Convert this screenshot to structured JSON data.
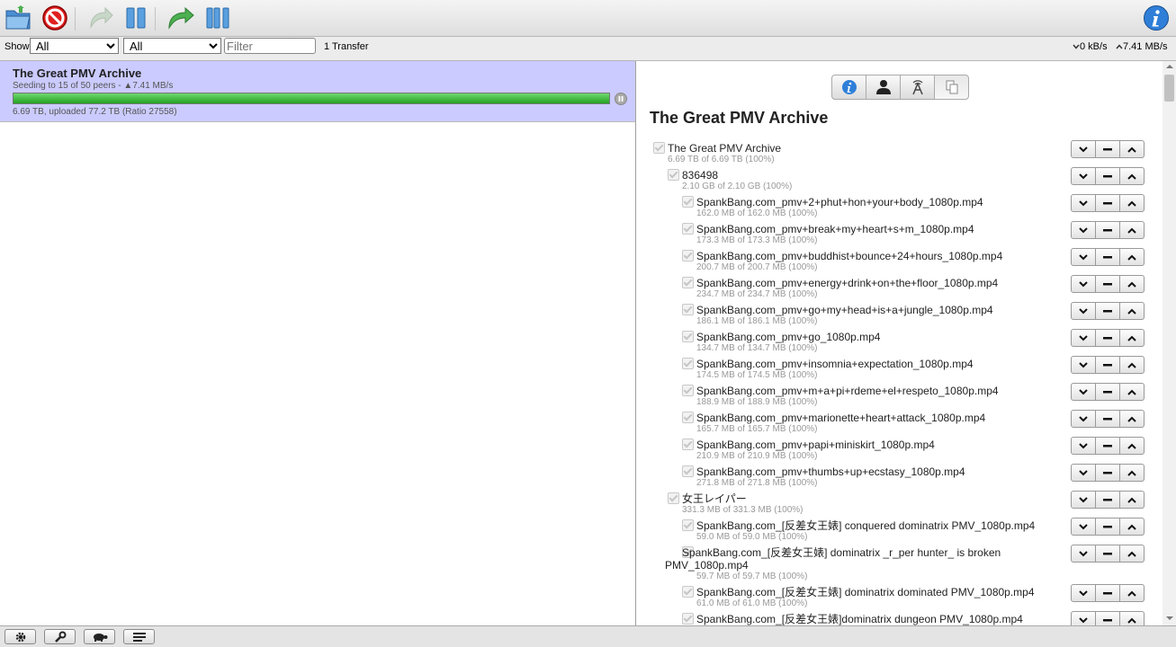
{
  "toolbar": {
    "buttons": [
      {
        "name": "open-torrent-button",
        "icon": "folder-open-icon"
      },
      {
        "name": "remove-torrent-button",
        "icon": "no-entry-icon"
      },
      {
        "name": "resume-selected-button",
        "icon": "resume-arrow-icon"
      },
      {
        "name": "pause-selected-button",
        "icon": "pause-icon"
      },
      {
        "name": "resume-all-button",
        "icon": "resume-all-arrow-icon"
      },
      {
        "name": "pause-all-button",
        "icon": "pause-all-icon"
      }
    ],
    "info_icon": "info-icon"
  },
  "filterbar": {
    "show_label": "Show",
    "status_filter": "All",
    "tracker_filter": "All",
    "filter_placeholder": "Filter",
    "transfer_count": "1 Transfer",
    "download_speed": "0 kB/s",
    "upload_speed": "7.41 MB/s"
  },
  "torrent": {
    "name": "The Great PMV Archive",
    "peers": "Seeding to 15 of 50 peers - ▲7.41 MB/s",
    "stats": "6.69 TB, uploaded 77.2 TB (Ratio 27558)",
    "progress_pct": 100,
    "progress_color": "#22a322"
  },
  "inspector": {
    "title": "The Great PMV Archive",
    "tabs": [
      "info-icon",
      "peers-icon",
      "trackers-icon",
      "files-icon"
    ],
    "files": [
      {
        "name": "The Great PMV Archive",
        "size": "6.69 TB of 6.69 TB (100%)",
        "level": 0
      },
      {
        "name": "836498",
        "size": "2.10 GB of 2.10 GB (100%)",
        "level": 1
      },
      {
        "name": "SpankBang.com_pmv+2+phut+hon+your+body_1080p.mp4",
        "size": "162.0 MB of 162.0 MB (100%)",
        "level": 2
      },
      {
        "name": "SpankBang.com_pmv+break+my+heart+s+m_1080p.mp4",
        "size": "173.3 MB of 173.3 MB (100%)",
        "level": 2
      },
      {
        "name": "SpankBang.com_pmv+buddhist+bounce+24+hours_1080p.mp4",
        "size": "200.7 MB of 200.7 MB (100%)",
        "level": 2
      },
      {
        "name": "SpankBang.com_pmv+energy+drink+on+the+floor_1080p.mp4",
        "size": "234.7 MB of 234.7 MB (100%)",
        "level": 2
      },
      {
        "name": "SpankBang.com_pmv+go+my+head+is+a+jungle_1080p.mp4",
        "size": "186.1 MB of 186.1 MB (100%)",
        "level": 2
      },
      {
        "name": "SpankBang.com_pmv+go_1080p.mp4",
        "size": "134.7 MB of 134.7 MB (100%)",
        "level": 2
      },
      {
        "name": "SpankBang.com_pmv+insomnia+expectation_1080p.mp4",
        "size": "174.5 MB of 174.5 MB (100%)",
        "level": 2
      },
      {
        "name": "SpankBang.com_pmv+m+a+pi+rdeme+el+respeto_1080p.mp4",
        "size": "188.9 MB of 188.9 MB (100%)",
        "level": 2
      },
      {
        "name": "SpankBang.com_pmv+marionette+heart+attack_1080p.mp4",
        "size": "165.7 MB of 165.7 MB (100%)",
        "level": 2
      },
      {
        "name": "SpankBang.com_pmv+papi+miniskirt_1080p.mp4",
        "size": "210.9 MB of 210.9 MB (100%)",
        "level": 2
      },
      {
        "name": "SpankBang.com_pmv+thumbs+up+ecstasy_1080p.mp4",
        "size": "271.8 MB of 271.8 MB (100%)",
        "level": 2
      },
      {
        "name": "女王レイパー",
        "size": "331.3 MB of 331.3 MB (100%)",
        "level": 1
      },
      {
        "name": "SpankBang.com_[反差女王婊] conquered dominatrix PMV_1080p.mp4",
        "size": "59.0 MB of 59.0 MB (100%)",
        "level": 2
      },
      {
        "name": "SpankBang.com_[反差女王婊] dominatrix _r_per hunter_ is broken PMV_1080p.mp4",
        "size": "59.7 MB of 59.7 MB (100%)",
        "level": 2,
        "wrap": true
      },
      {
        "name": "SpankBang.com_[反差女王婊] dominatrix dominated PMV_1080p.mp4",
        "size": "61.0 MB of 61.0 MB (100%)",
        "level": 2
      },
      {
        "name": "SpankBang.com_[反差女王婊]dominatrix dungeon PMV_1080p.mp4",
        "size": "",
        "level": 2
      }
    ]
  },
  "bottombar": {
    "buttons": [
      "gear-icon",
      "wrench-icon",
      "turtle-icon",
      "sort-list-icon"
    ]
  }
}
